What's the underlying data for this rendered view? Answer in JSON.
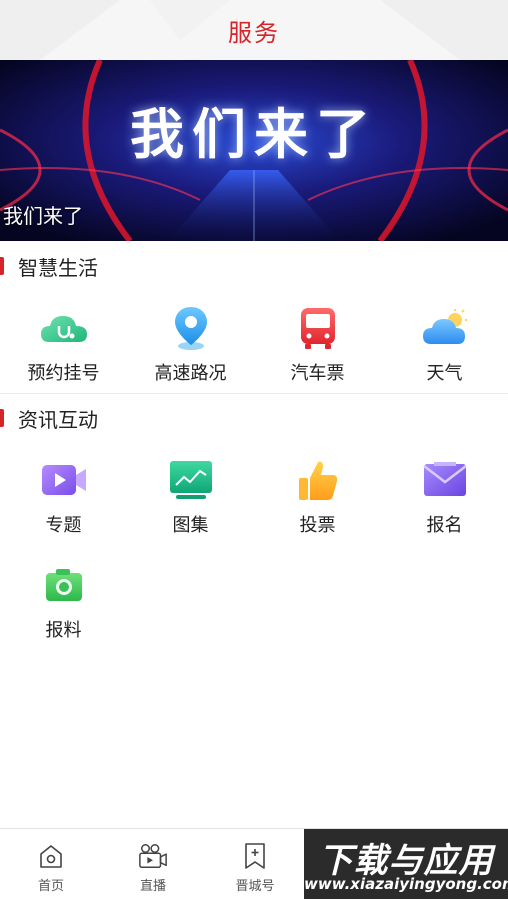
{
  "header": {
    "title": "服务"
  },
  "banner": {
    "headline": "我们来了",
    "caption": "我们来了"
  },
  "sections": [
    {
      "title": "智慧生活",
      "items": [
        {
          "label": "预约挂号",
          "icon": "cloud-stethoscope-icon"
        },
        {
          "label": "高速路况",
          "icon": "location-pin-icon"
        },
        {
          "label": "汽车票",
          "icon": "bus-icon"
        },
        {
          "label": "天气",
          "icon": "weather-cloud-icon"
        }
      ]
    },
    {
      "title": "资讯互动",
      "items": [
        {
          "label": "专题",
          "icon": "video-camera-icon"
        },
        {
          "label": "图集",
          "icon": "chart-screen-icon"
        },
        {
          "label": "投票",
          "icon": "thumbs-up-icon"
        },
        {
          "label": "报名",
          "icon": "envelope-icon"
        },
        {
          "label": "报料",
          "icon": "camera-icon"
        }
      ]
    }
  ],
  "tabbar": [
    {
      "label": "首页",
      "icon": "home-icon"
    },
    {
      "label": "直播",
      "icon": "live-camera-icon"
    },
    {
      "label": "晋城号",
      "icon": "bookmark-icon"
    }
  ],
  "watermark": {
    "line1": "下载与应用",
    "line2": "www.xiazaiyingyong.com"
  },
  "colors": {
    "accent": "#d6242a",
    "banner_bg": "#0a0a3a"
  }
}
